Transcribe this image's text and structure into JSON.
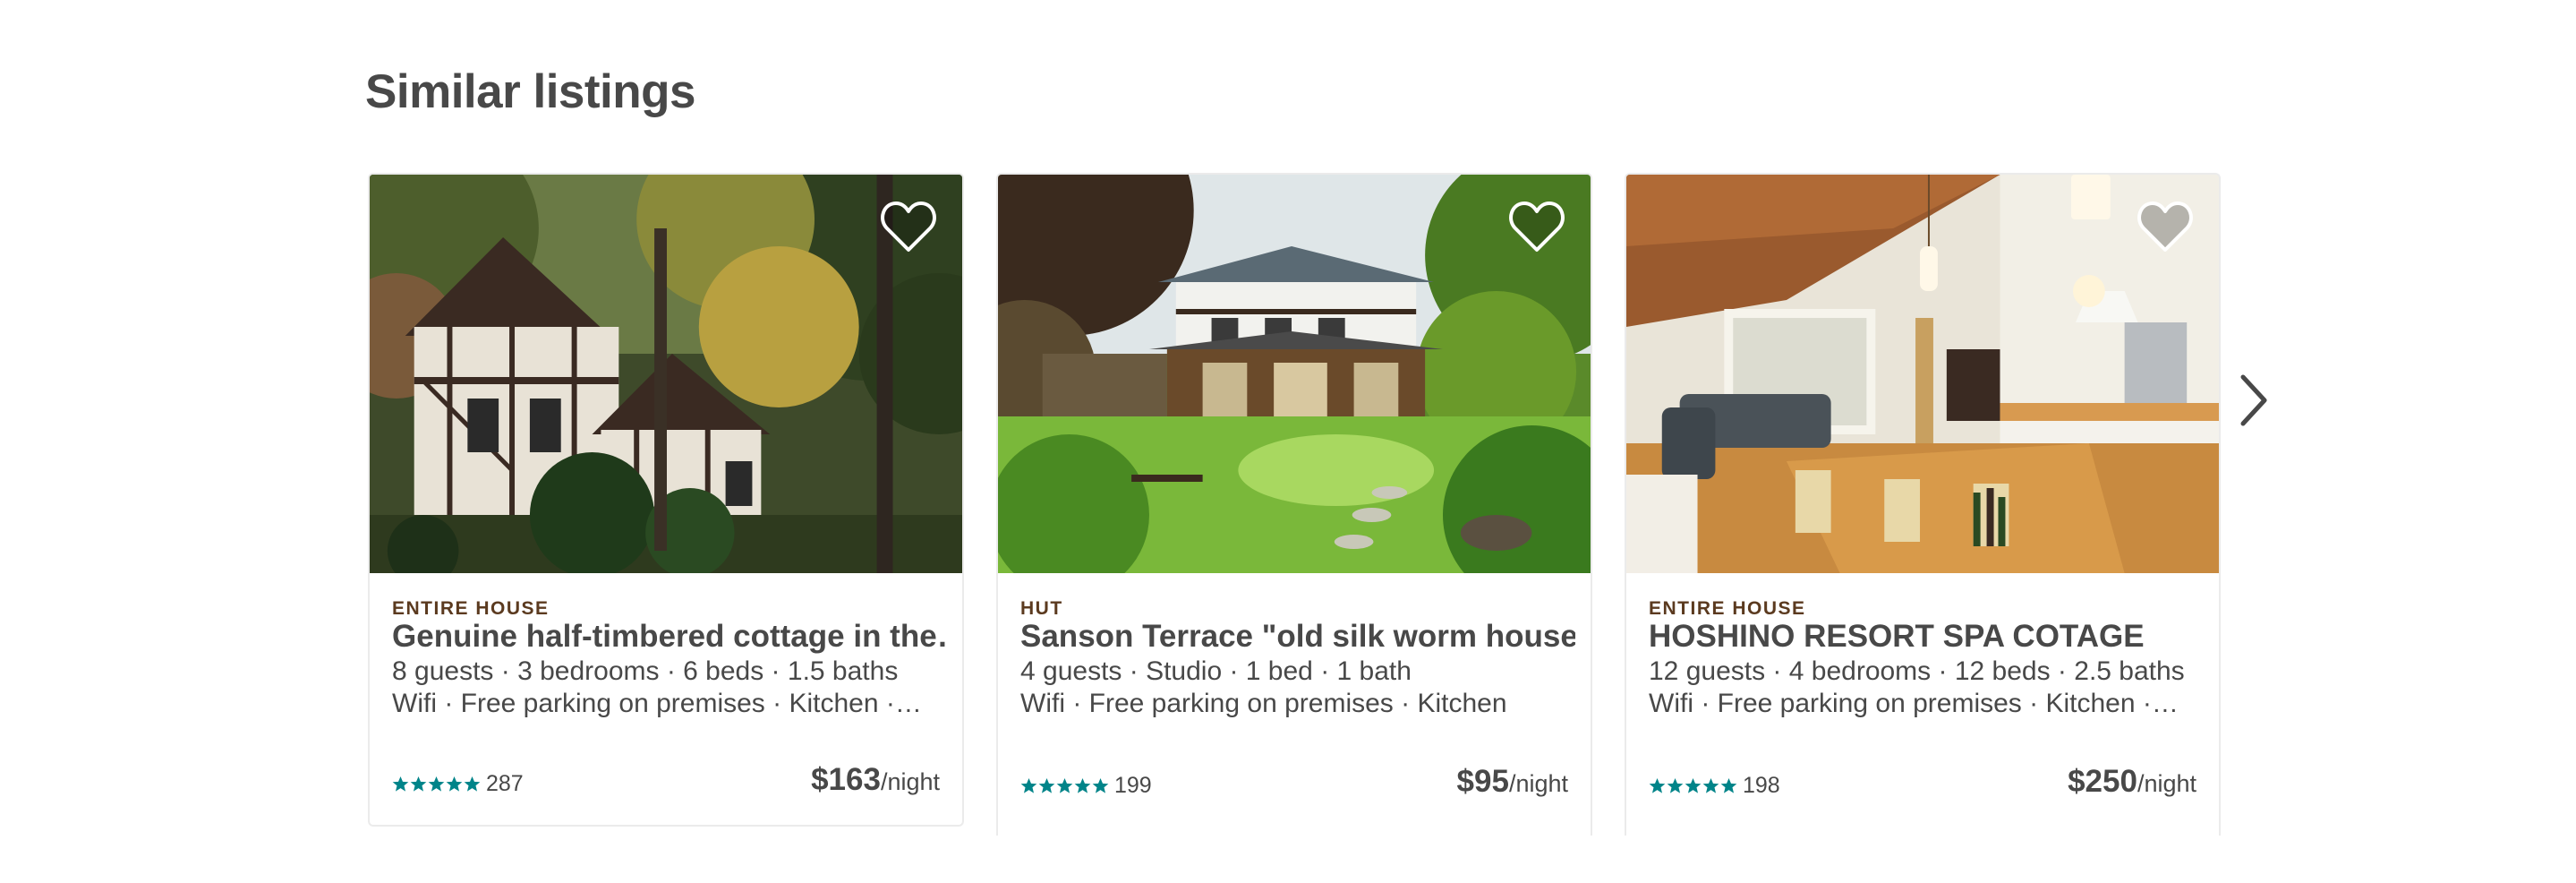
{
  "section": {
    "title": "Similar listings"
  },
  "listings": [
    {
      "kind": "ENTIRE HOUSE",
      "title": "Genuine half-timbered cottage in the…",
      "specs": "8 guests · 3 bedrooms · 6 beds · 1.5 baths",
      "amenities": "Wifi · Free parking on premises · Kitchen ·…",
      "stars": 5,
      "reviews": "287",
      "price": "$163",
      "per": "/night",
      "photo": "half-timbered-cottage-photo"
    },
    {
      "kind": "HUT",
      "title": "Sanson Terrace \"old silk worm house\"",
      "specs": "4 guests · Studio · 1 bed · 1 bath",
      "amenities": "Wifi · Free parking on premises · Kitchen",
      "stars": 5,
      "reviews": "199",
      "price": "$95",
      "per": "/night",
      "photo": "silk-worm-house-garden-photo"
    },
    {
      "kind": "ENTIRE HOUSE",
      "title": "HOSHINO RESORT SPA COTAGE",
      "specs": "12 guests · 4 bedrooms · 12 beds · 2.5 baths",
      "amenities": "Wifi · Free parking on premises · Kitchen ·…",
      "stars": 5,
      "reviews": "198",
      "price": "$250",
      "per": "/night",
      "photo": "living-room-interior-photo"
    }
  ],
  "colors": {
    "text": "#484848",
    "star": "#008489",
    "kind_label": "#5b3a1f",
    "border": "#ebebeb"
  },
  "icons": {
    "save": "heart-icon",
    "rating": "star-icon",
    "navigate": "chevron-right-icon"
  }
}
